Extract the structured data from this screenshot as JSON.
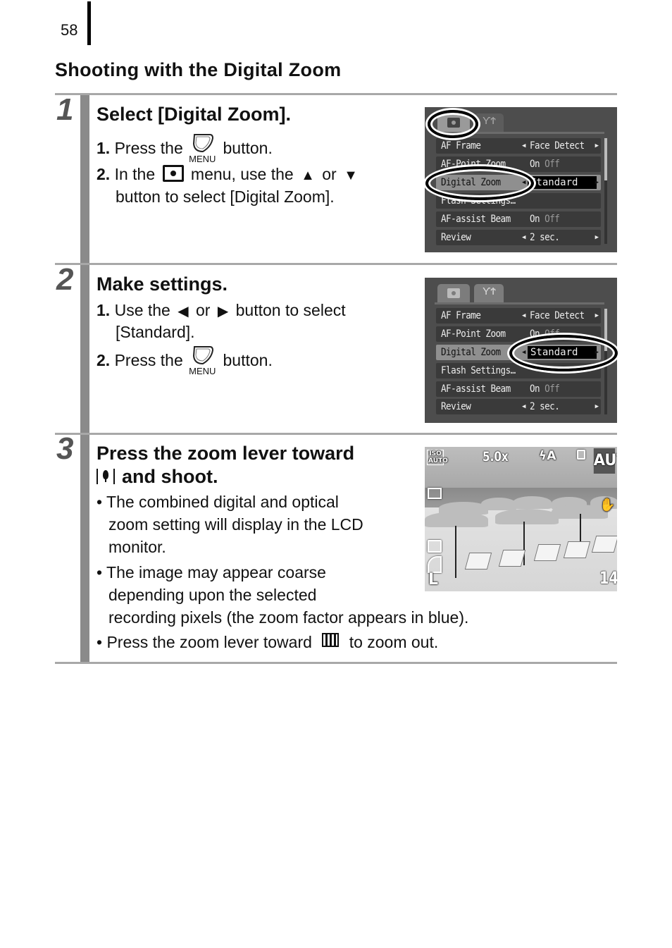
{
  "page_number": "58",
  "section_title": "Shooting with the Digital Zoom",
  "icons": {
    "menu_button_label": "MENU"
  },
  "steps": [
    {
      "number": "1",
      "title": "Select [Digital Zoom].",
      "items": [
        {
          "num": "1.",
          "pre": "Press the",
          "post": "button."
        },
        {
          "num": "2.",
          "pre": "In the",
          "mid": "menu, use the",
          "or": "or",
          "line2": "button to select [Digital Zoom]."
        }
      ],
      "screen": {
        "tabs": [
          "camera-tab",
          "tools-tab"
        ],
        "rows": [
          {
            "label": "AF Frame",
            "value": "Face Detect",
            "arrows": true
          },
          {
            "label": "AF-Point Zoom",
            "value_on": "On",
            "value_off": "Off"
          },
          {
            "label": "Digital Zoom",
            "value": "Standard",
            "arrows": true,
            "selected": true
          },
          {
            "label": "Flash Settings…"
          },
          {
            "label": "AF-assist Beam",
            "value_on": "On",
            "value_off": "Off"
          },
          {
            "label": "Review",
            "value": "2 sec.",
            "arrows": true
          }
        ]
      }
    },
    {
      "number": "2",
      "title": "Make settings.",
      "items": [
        {
          "num": "1.",
          "pre": "Use the",
          "or": "or",
          "post": "button to select",
          "line2": "[Standard]."
        },
        {
          "num": "2.",
          "pre": "Press the",
          "post": "button."
        }
      ],
      "screen": {
        "rows": [
          {
            "label": "AF Frame",
            "value": "Face Detect",
            "arrows": true
          },
          {
            "label": "AF-Point Zoom",
            "value_on": "On",
            "value_off": "Off"
          },
          {
            "label": "Digital Zoom",
            "value": "Standard",
            "arrows": true,
            "selected": true
          },
          {
            "label": "Flash Settings…"
          },
          {
            "label": "AF-assist Beam",
            "value_on": "On",
            "value_off": "Off"
          },
          {
            "label": "Review",
            "value": "2 sec.",
            "arrows": true
          }
        ]
      }
    },
    {
      "number": "3",
      "title_line1": "Press the zoom lever toward",
      "title_line2": "and shoot.",
      "bullets": [
        {
          "lines": [
            "The combined digital and optical",
            "zoom setting will display in the LCD",
            "monitor."
          ]
        },
        {
          "lines": [
            "The image may appear coarse",
            "depending upon the selected",
            "recording pixels (the zoom factor appears in blue)."
          ]
        },
        {
          "pre": "Press the zoom lever toward",
          "post": "to zoom out."
        }
      ],
      "screen": {
        "iso": "ISO AUTO",
        "zoom_factor": "5.0x",
        "flash": "ϟA",
        "mode": "AUTO",
        "shots_remaining": "14",
        "size": "L"
      }
    }
  ]
}
